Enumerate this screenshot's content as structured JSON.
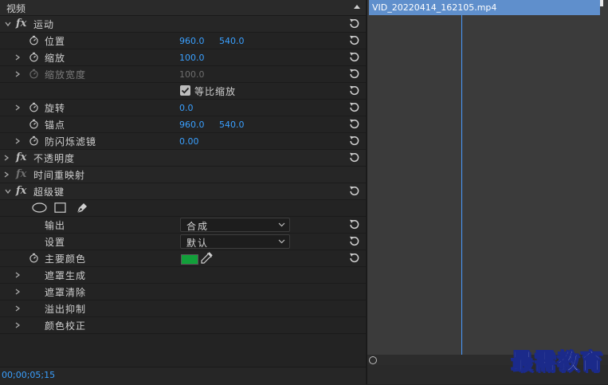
{
  "panel": {
    "title": "视频"
  },
  "rows": {
    "motion": {
      "label": "运动"
    },
    "position": {
      "label": "位置",
      "x": "960.0",
      "y": "540.0"
    },
    "scale": {
      "label": "缩放",
      "value": "100.0"
    },
    "scale_width": {
      "label": "缩放宽度",
      "value": "100.0"
    },
    "uniform_scale": {
      "label": "等比缩放",
      "checked": true
    },
    "rotation": {
      "label": "旋转",
      "value": "0.0"
    },
    "anchor": {
      "label": "锚点",
      "x": "960.0",
      "y": "540.0"
    },
    "anti_flicker": {
      "label": "防闪烁滤镜",
      "value": "0.00"
    },
    "opacity": {
      "label": "不透明度"
    },
    "time_remap": {
      "label": "时间重映射"
    },
    "ultra_key": {
      "label": "超级键"
    },
    "output": {
      "label": "输出",
      "selected": "合成"
    },
    "setting": {
      "label": "设置",
      "selected": "默认"
    },
    "key_color": {
      "label": "主要颜色",
      "color": "#12a03a"
    },
    "matte_generation": {
      "label": "遮罩生成"
    },
    "matte_cleanup": {
      "label": "遮罩清除"
    },
    "spill_suppression": {
      "label": "溢出抑制"
    },
    "color_correction": {
      "label": "颜色校正"
    }
  },
  "footer": {
    "timecode": "00;00;05;15"
  },
  "timeline": {
    "clip_name": "VID_20220414_162105.mp4"
  },
  "watermark": {
    "text": "最需教育"
  },
  "icons": {
    "fx": "fx-icon",
    "stopwatch": "stopwatch-icon",
    "reset": "reset-icon",
    "chevron": "chevron-icon",
    "ellipse": "ellipse-mask-icon",
    "rectangle": "rectangle-mask-icon",
    "pen": "pen-mask-icon",
    "eyedropper": "eyedropper-icon"
  },
  "colors": {
    "accent": "#3aa0ff",
    "clip": "#5f8fcc",
    "playhead": "#4a9bff"
  }
}
